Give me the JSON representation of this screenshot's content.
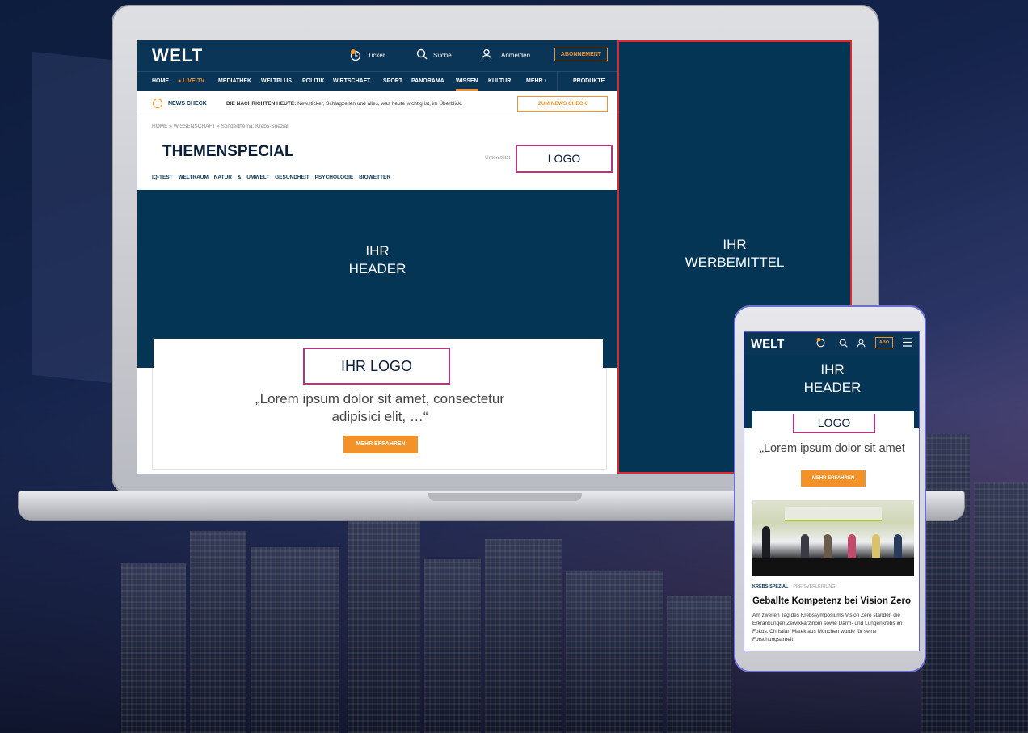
{
  "site": {
    "logo": "WELT"
  },
  "topbar": {
    "ticker": "Ticker",
    "search": "Suche",
    "login": "Anmelden",
    "abo": "ABONNEMENT"
  },
  "nav": [
    "HOME",
    "LIVE-TV",
    "MEDIATHEK",
    "WELTPLUS",
    "POLITIK",
    "WIRTSCHAFT",
    "SPORT",
    "PANORAMA",
    "WISSEN",
    "KULTUR",
    "MEHR",
    "PRODUKTE"
  ],
  "newscheck": {
    "label": "NEWS CHECK",
    "prefix": "DIE NACHRICHTEN HEUTE:",
    "text": "Newsticker, Schlagzeilen und alles, was heute wichtig ist, im Überblick.",
    "button": "ZUM NEWS CHECK"
  },
  "breadcrumb": "HOME » WISSENSCHAFT » Sonderthema: Krebs-Spezial",
  "page": {
    "title": "THEMENSPECIAL",
    "support": "Unterstützt",
    "logo_box": "LOGO"
  },
  "subnav": [
    "IQ-TEST",
    "WELTRAUM",
    "NATUR & UMWELT",
    "GESUNDHEIT",
    "PSYCHOLOGIE",
    "BIOWETTER"
  ],
  "header": {
    "line1": "IHR",
    "line2": "HEADER"
  },
  "content": {
    "logo": "IHR LOGO",
    "quote1": "„Lorem ipsum dolor sit amet, consectetur",
    "quote2": "adipisici elit, …“",
    "button": "MEHR ERFAHREN"
  },
  "ad": {
    "line1": "IHR",
    "line2": "WERBEMITTEL"
  },
  "phone": {
    "logo": "WELT",
    "abo": "ABO",
    "header1": "IHR",
    "header2": "HEADER",
    "logo_box": "LOGO",
    "quote": "„Lorem ipsum dolor sit amet",
    "button": "MEHR ERFAHREN",
    "tag1": "KREBS-SPEZIAL",
    "tag2": "PREISVERLEIHUNG",
    "headline": "Geballte Kompetenz bei Vision Zero",
    "body": "Am zweiten Tag des Krebssymposiums Vision Zero standen die Erkrankungen Zervixkarzinom sowie Darm- und Lungenkrebs im Fokus. Christian Matek aus München wurde für seine Forschungsarbeit"
  }
}
